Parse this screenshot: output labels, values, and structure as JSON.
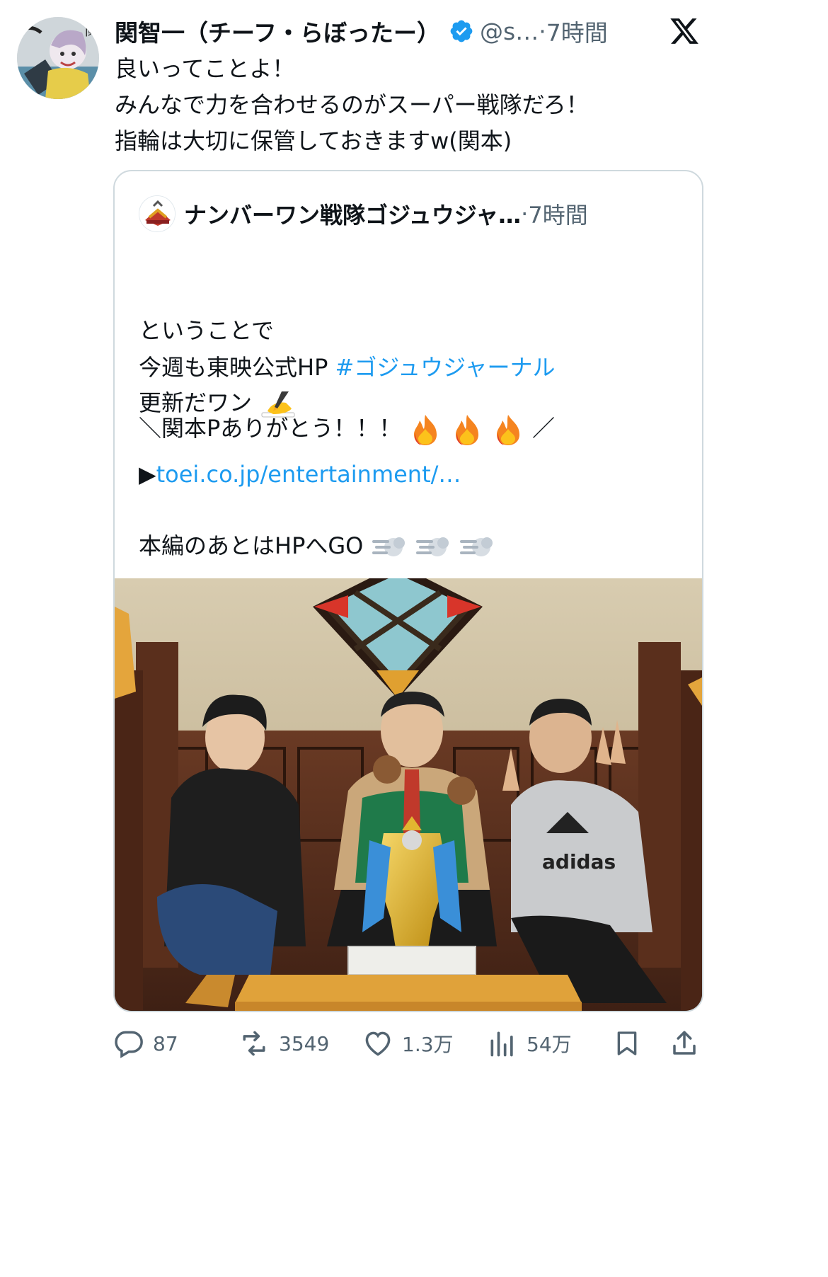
{
  "tweet": {
    "display_name": "関智一（チーフ・らぼったー）",
    "handle": "@s…",
    "separator": "·",
    "time": "7時間",
    "text_lines": [
      "良いってことよ！",
      "みんなで力を合わせるのがスーパー戦隊だろ！",
      "指輪は大切に保管しておきますw(関本)"
    ]
  },
  "quote": {
    "display_name": "ナンバーワン戦隊ゴジュウジャ…",
    "separator": "·",
    "time": "7時間",
    "line1": "＼関本Pありがとう！！！",
    "line1_end": "／",
    "line2": "ということで",
    "line3_prefix": "今週も東映公式HP ",
    "hashtag": "#ゴジュウジャーナル",
    "line4": "更新だワン",
    "link_prefix": "▶",
    "link_text": "toei.co.jp/entertainment/…",
    "line6": "本編のあとはHPへGO"
  },
  "actions": {
    "replies": "87",
    "reposts": "3549",
    "likes": "1.3万",
    "views": "54万"
  },
  "icons": {
    "verified": "verified-badge-icon",
    "brand": "x-logo-icon",
    "reply": "reply-icon",
    "repost": "repost-icon",
    "like": "heart-icon",
    "views": "views-icon",
    "bookmark": "bookmark-icon",
    "share": "share-icon"
  },
  "colors": {
    "text": "#0f1419",
    "secondary": "#536471",
    "link": "#1d9bf0",
    "border": "#cfd9de"
  }
}
